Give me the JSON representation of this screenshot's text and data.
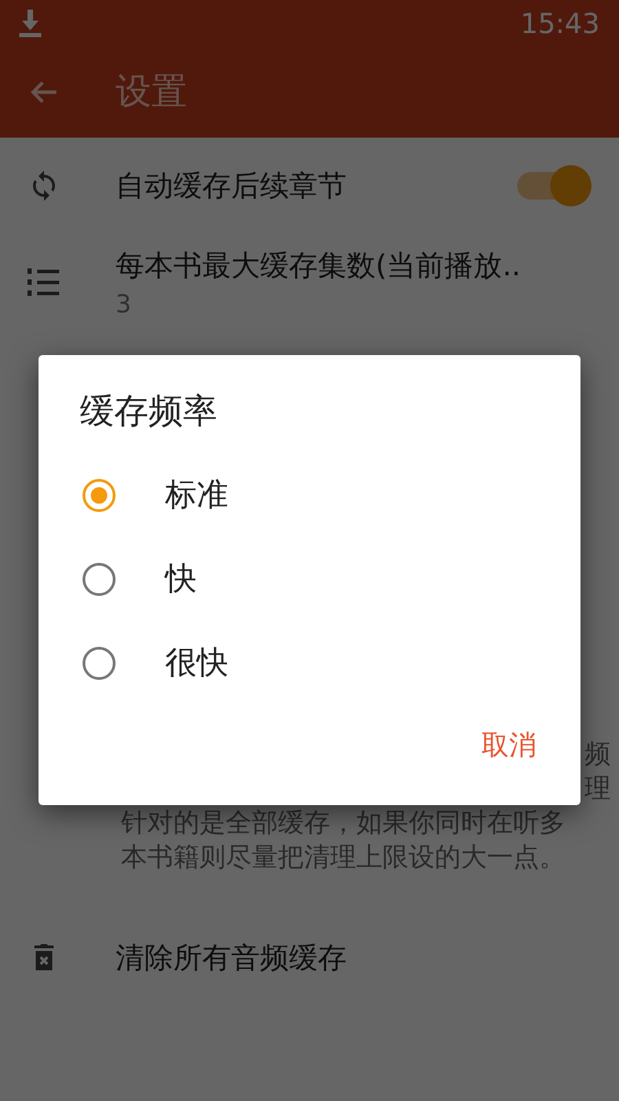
{
  "status_bar": {
    "time": "15:43"
  },
  "toolbar": {
    "title": "设置"
  },
  "settings": [
    {
      "kind": "toggle",
      "title": "自动缓存后续章节",
      "on": true
    },
    {
      "kind": "value",
      "title": "每本书最大缓存集数(当前播放..",
      "value": "3"
    }
  ],
  "description": {
    "fragments": [
      "频",
      "理"
    ],
    "lines": [
      "针对的是全部缓存，如果你同时在听多",
      "本书籍则尽量把清理上限设的大一点。"
    ]
  },
  "bottom_item": {
    "title": "清除所有音频缓存"
  },
  "dialog": {
    "title": "缓存频率",
    "options": [
      {
        "label": "标准",
        "selected": true
      },
      {
        "label": "快",
        "selected": false
      },
      {
        "label": "很快",
        "selected": false
      }
    ],
    "button": "取消"
  }
}
